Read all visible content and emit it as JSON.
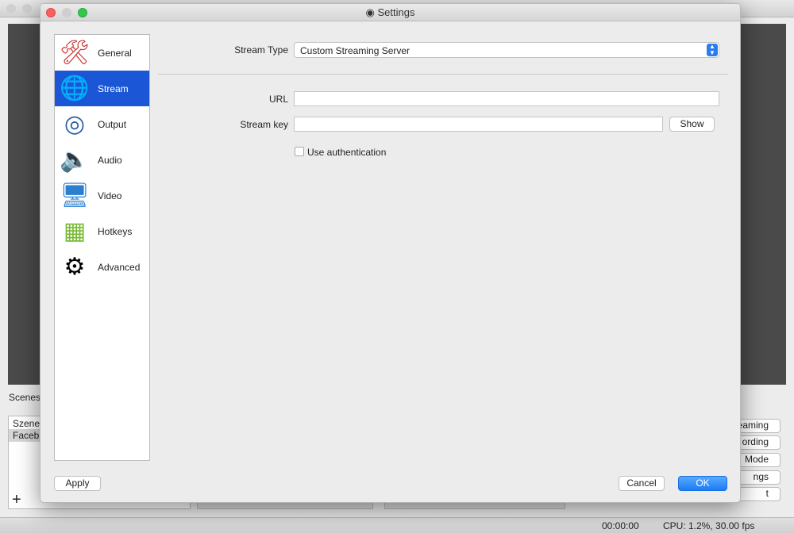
{
  "background": {
    "scenes_label": "Scenes",
    "scenes": [
      "Szene",
      "Faceb"
    ],
    "buttons": [
      "eaming",
      "ording",
      "Mode",
      "ngs",
      "t"
    ],
    "status_time": "00:00:00",
    "status_cpu": "CPU: 1.2%, 30.00 fps"
  },
  "dialog": {
    "title": "Settings",
    "sidebar": [
      {
        "label": "General",
        "icon": "general-icon"
      },
      {
        "label": "Stream",
        "icon": "globe-icon",
        "selected": true
      },
      {
        "label": "Output",
        "icon": "broadcast-icon"
      },
      {
        "label": "Audio",
        "icon": "speaker-icon"
      },
      {
        "label": "Video",
        "icon": "monitor-icon"
      },
      {
        "label": "Hotkeys",
        "icon": "keyboard-icon"
      },
      {
        "label": "Advanced",
        "icon": "gears-icon"
      }
    ],
    "stream_type_label": "Stream Type",
    "stream_type_value": "Custom Streaming Server",
    "url_label": "URL",
    "url_value": "",
    "key_label": "Stream key",
    "key_value": "",
    "show_button": "Show",
    "auth_label": "Use authentication",
    "auth_checked": false,
    "apply": "Apply",
    "cancel": "Cancel",
    "ok": "OK",
    "accent": "#1a56d6"
  }
}
